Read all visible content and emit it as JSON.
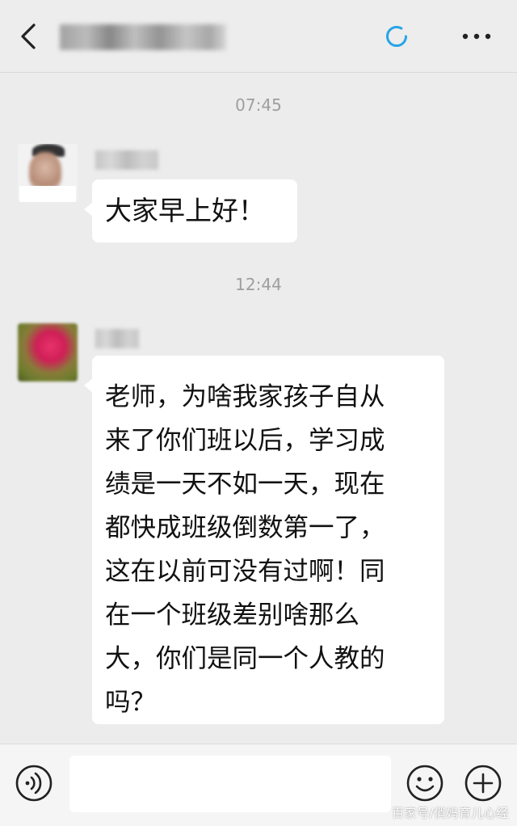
{
  "header": {
    "title_icon": "sync-icon",
    "back_icon": "back-chevron-icon",
    "more_icon": "more-dots-icon"
  },
  "messages": [
    {
      "timestamp": "07:45",
      "text": "大家早上好！"
    },
    {
      "timestamp": "12:44",
      "lines": [
        "老师，为啥我家孩子自从",
        "来了你们班以后，学习成",
        "绩是一天不如一天，现在",
        "都快成班级倒数第一了，",
        "这在以前可没有过啊！同",
        "在一个班级差别啥那么",
        "大，你们是同一个人教的",
        "吗？"
      ]
    }
  ],
  "input_bar": {
    "value": "",
    "voice_icon": "voice-icon",
    "emoji_icon": "emoji-icon",
    "plus_icon": "plus-icon"
  },
  "watermark": "百家号/俏妈育儿心经",
  "colors": {
    "background": "#ececec",
    "bubble": "#ffffff",
    "accent": "#27a4e6",
    "timestamp": "#9e9e9e"
  }
}
